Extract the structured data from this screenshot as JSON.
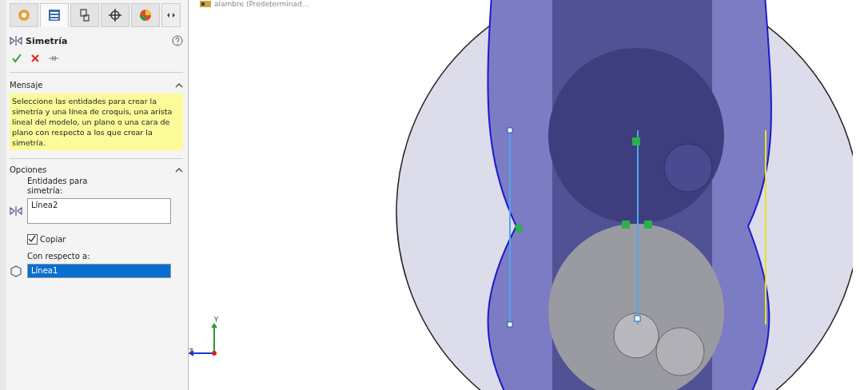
{
  "panel_tabs": [
    {
      "kind": "features",
      "selected": false
    },
    {
      "kind": "properties",
      "selected": true
    },
    {
      "kind": "config",
      "selected": false
    },
    {
      "kind": "target",
      "selected": false
    },
    {
      "kind": "appearance",
      "selected": false
    }
  ],
  "feature": {
    "title": "Simetría"
  },
  "message": {
    "title": "Mensaje",
    "text": "Seleccione las entidades para crear la simetría y una línea de croquis, una arista lineal del modelo, un plano o una cara de plano con respecto a los que crear la simetría."
  },
  "options": {
    "title": "Opciones",
    "entities_label": "Entidades para simetría:",
    "entities_value": "Línea2",
    "copy": {
      "label": "Copiar",
      "checked": true
    },
    "about_label": "Con respecto a:",
    "about_value": "Línea1",
    "about_selected": true
  },
  "viewport": {
    "breadcrumb": "alambre (Predeterminad...",
    "axes": {
      "y": "Y",
      "z": "Z"
    }
  }
}
